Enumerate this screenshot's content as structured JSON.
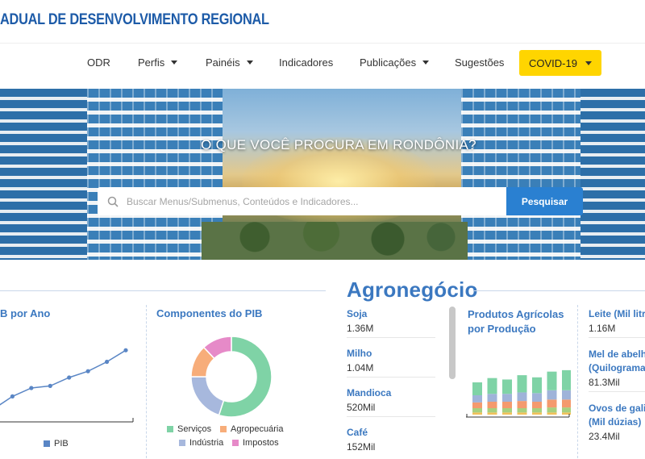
{
  "header": {
    "brand": "ADUAL DE DESENVOLVIMENTO REGIONAL"
  },
  "nav": {
    "odr": "ODR",
    "perfis": "Perfis",
    "paineis": "Painéis",
    "indicadores": "Indicadores",
    "publicacoes": "Publicações",
    "sugestoes": "Sugestões",
    "covid": "COVID-19",
    "covid_color": "#ffd500"
  },
  "hero": {
    "title": "O QUE VOCÊ PROCURA EM RONDÔNIA?",
    "search_placeholder": "Buscar Menus/Submenus, Conteúdos e Indicadores...",
    "search_button": "Pesquisar",
    "search_button_color": "#2a80d1"
  },
  "pib_ano": {
    "title": "B por Ano",
    "legend": "PIB",
    "color": "#5a86c5"
  },
  "componentes": {
    "title": "Componentes do PIB",
    "donut": [
      {
        "name": "Serviços",
        "value": 55,
        "color": "#7fd3a6"
      },
      {
        "name": "Indústria",
        "value": 20,
        "color": "#a7b8dd"
      },
      {
        "name": "Agropecuária",
        "value": 13,
        "color": "#f7ad7a"
      },
      {
        "name": "Impostos",
        "value": 12,
        "color": "#e68ac8"
      }
    ]
  },
  "agro": {
    "title": "Agronegócio",
    "items": [
      {
        "label": "Soja",
        "value": "1.36M"
      },
      {
        "label": "Milho",
        "value": "1.04M"
      },
      {
        "label": "Mandioca",
        "value": "520Mil"
      },
      {
        "label": "Café",
        "value": "152Mil"
      }
    ],
    "produtos_title": "Produtos Agrícolas por Produção",
    "right_items": [
      {
        "label": "Leite (Mil litr",
        "value": "1.16M"
      },
      {
        "label": "Mel de abelh (Quilograma",
        "value": "81.3Mil"
      },
      {
        "label": "Ovos de gali (Mil dúzias)",
        "value": "23.4Mil"
      }
    ]
  },
  "chart_data": [
    {
      "type": "line",
      "title": "",
      "series": [
        {
          "name": "PIB",
          "values": [
            10,
            22,
            30,
            32,
            40,
            46,
            55,
            66
          ]
        }
      ],
      "ylim": [
        0,
        80
      ]
    },
    {
      "type": "pie",
      "title": "Componentes do PIB",
      "categories": [
        "Serviços",
        "Indústria",
        "Agropecuária",
        "Impostos"
      ],
      "values": [
        55,
        20,
        13,
        12
      ]
    },
    {
      "type": "bar",
      "title": "Produtos Agrícolas por Produção",
      "categories": [
        "1",
        "2",
        "3",
        "4",
        "5",
        "6",
        "7"
      ],
      "series": [
        {
          "values": [
            3,
            3,
            3,
            3,
            3,
            3,
            3
          ]
        },
        {
          "values": [
            6,
            6,
            6,
            6,
            6,
            7,
            7
          ]
        },
        {
          "values": [
            8,
            9,
            9,
            10,
            9,
            11,
            11
          ]
        },
        {
          "values": [
            10,
            11,
            11,
            12,
            12,
            13,
            13
          ]
        },
        {
          "values": [
            18,
            22,
            20,
            24,
            22,
            26,
            28
          ]
        }
      ],
      "colors": [
        "#f1c15a",
        "#a7d07f",
        "#f49a6e",
        "#9fb3d9",
        "#7fd3a6"
      ],
      "ylim": [
        0,
        90
      ]
    }
  ]
}
